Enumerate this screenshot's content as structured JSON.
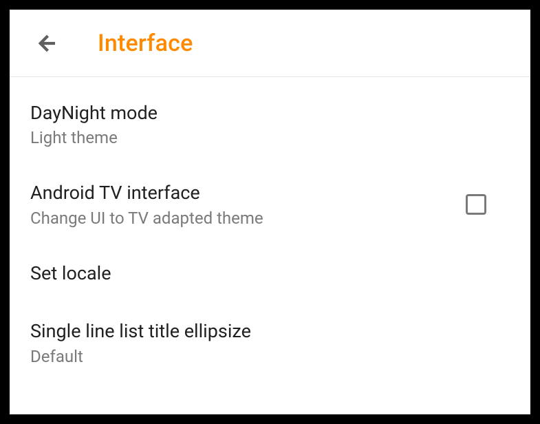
{
  "header": {
    "title": "Interface"
  },
  "settings": [
    {
      "title": "DayNight mode",
      "subtitle": "Light theme",
      "has_checkbox": false
    },
    {
      "title": "Android TV interface",
      "subtitle": "Change UI to TV adapted theme",
      "has_checkbox": true,
      "checked": false
    },
    {
      "title": "Set locale",
      "subtitle": null,
      "has_checkbox": false
    },
    {
      "title": "Single line list title ellipsize",
      "subtitle": "Default",
      "has_checkbox": false
    }
  ]
}
